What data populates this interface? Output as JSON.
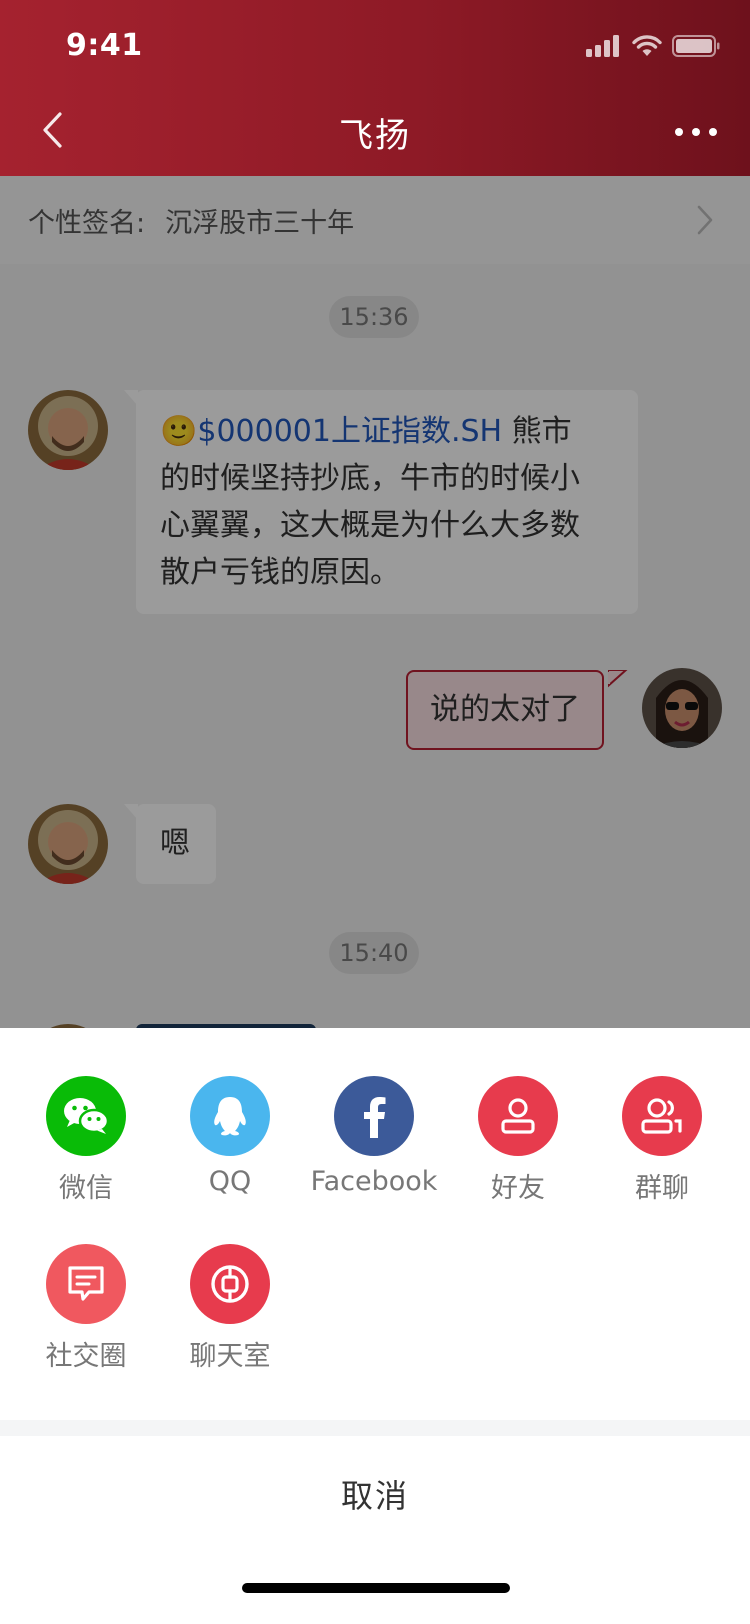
{
  "status_bar": {
    "time": "9:41"
  },
  "nav": {
    "title": "飞扬",
    "back_icon": "chevron-left-icon",
    "more_icon": "more-dots-icon"
  },
  "signature": {
    "label": "个性签名:",
    "value": "沉浮股市三十年"
  },
  "chat": {
    "timestamps": [
      "15:36",
      "15:40"
    ],
    "messages": [
      {
        "direction": "incoming",
        "emoji": "🙂",
        "stock_tag": "$000001上证指数.SH",
        "lines": [
          "熊市",
          "的时候坚持抄底，牛市的时候小",
          "心翼翼，这大概是为什么大多数",
          "散户亏钱的原因。"
        ]
      },
      {
        "direction": "outgoing",
        "text": "说的太对了"
      },
      {
        "direction": "incoming",
        "text": "嗯"
      }
    ]
  },
  "share_sheet": {
    "items": [
      {
        "label": "微信",
        "icon": "wechat-icon",
        "color": "#09bb07"
      },
      {
        "label": "QQ",
        "icon": "qq-icon",
        "color": "#4ab6ee"
      },
      {
        "label": "Facebook",
        "icon": "facebook-icon",
        "color": "#3c5a99"
      },
      {
        "label": "好友",
        "icon": "friend-icon",
        "color": "#e73b4d"
      },
      {
        "label": "群聊",
        "icon": "group-chat-icon",
        "color": "#e73b4d"
      },
      {
        "label": "社交圈",
        "icon": "social-circle-icon",
        "color": "#f0585f"
      },
      {
        "label": "聊天室",
        "icon": "chatroom-icon",
        "color": "#e73b4d"
      }
    ],
    "cancel_label": "取消"
  },
  "colors": {
    "header_start": "#a5222f",
    "header_end": "#6e111c",
    "link": "#2156b8",
    "outgoing_border": "#b51f33"
  }
}
